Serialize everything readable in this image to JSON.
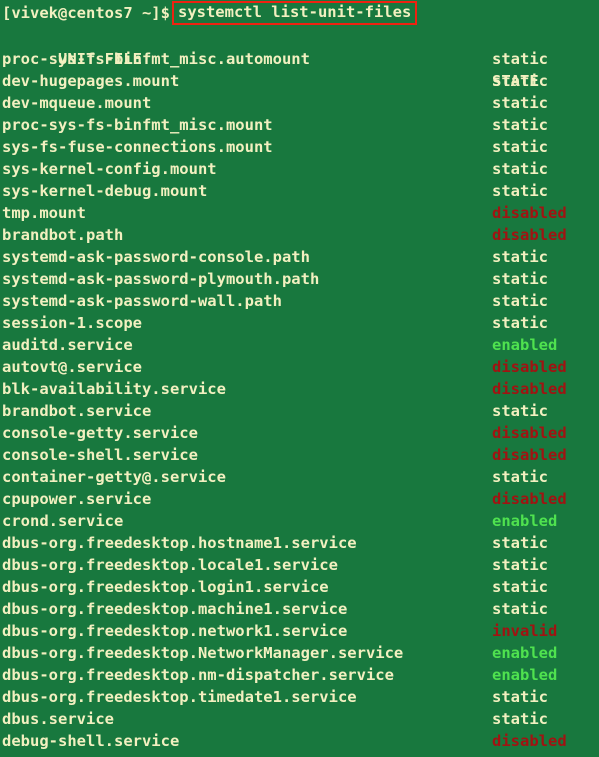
{
  "terminal": {
    "prompt": "[vivek@centos7 ~]$",
    "command": "systemctl list-unit-files",
    "command_box_color": "#ee2211",
    "background_color": "#18783e",
    "foreground_color": "#f2f0c0",
    "enabled_color": "#4fe24f",
    "disabled_color": "#a11312"
  },
  "table": {
    "headers": {
      "unit_file": "UNIT FILE",
      "state": "STATE"
    },
    "rows": [
      {
        "unit": "proc-sys-fs-binfmt_misc.automount",
        "state": "static"
      },
      {
        "unit": "dev-hugepages.mount",
        "state": "static"
      },
      {
        "unit": "dev-mqueue.mount",
        "state": "static"
      },
      {
        "unit": "proc-sys-fs-binfmt_misc.mount",
        "state": "static"
      },
      {
        "unit": "sys-fs-fuse-connections.mount",
        "state": "static"
      },
      {
        "unit": "sys-kernel-config.mount",
        "state": "static"
      },
      {
        "unit": "sys-kernel-debug.mount",
        "state": "static"
      },
      {
        "unit": "tmp.mount",
        "state": "disabled"
      },
      {
        "unit": "brandbot.path",
        "state": "disabled"
      },
      {
        "unit": "systemd-ask-password-console.path",
        "state": "static"
      },
      {
        "unit": "systemd-ask-password-plymouth.path",
        "state": "static"
      },
      {
        "unit": "systemd-ask-password-wall.path",
        "state": "static"
      },
      {
        "unit": "session-1.scope",
        "state": "static"
      },
      {
        "unit": "auditd.service",
        "state": "enabled"
      },
      {
        "unit": "autovt@.service",
        "state": "disabled"
      },
      {
        "unit": "blk-availability.service",
        "state": "disabled"
      },
      {
        "unit": "brandbot.service",
        "state": "static"
      },
      {
        "unit": "console-getty.service",
        "state": "disabled"
      },
      {
        "unit": "console-shell.service",
        "state": "disabled"
      },
      {
        "unit": "container-getty@.service",
        "state": "static"
      },
      {
        "unit": "cpupower.service",
        "state": "disabled"
      },
      {
        "unit": "crond.service",
        "state": "enabled"
      },
      {
        "unit": "dbus-org.freedesktop.hostname1.service",
        "state": "static"
      },
      {
        "unit": "dbus-org.freedesktop.locale1.service",
        "state": "static"
      },
      {
        "unit": "dbus-org.freedesktop.login1.service",
        "state": "static"
      },
      {
        "unit": "dbus-org.freedesktop.machine1.service",
        "state": "static"
      },
      {
        "unit": "dbus-org.freedesktop.network1.service",
        "state": "invalid"
      },
      {
        "unit": "dbus-org.freedesktop.NetworkManager.service",
        "state": "enabled"
      },
      {
        "unit": "dbus-org.freedesktop.nm-dispatcher.service",
        "state": "enabled"
      },
      {
        "unit": "dbus-org.freedesktop.timedate1.service",
        "state": "static"
      },
      {
        "unit": "dbus.service",
        "state": "static"
      },
      {
        "unit": "debug-shell.service",
        "state": "disabled"
      }
    ]
  }
}
